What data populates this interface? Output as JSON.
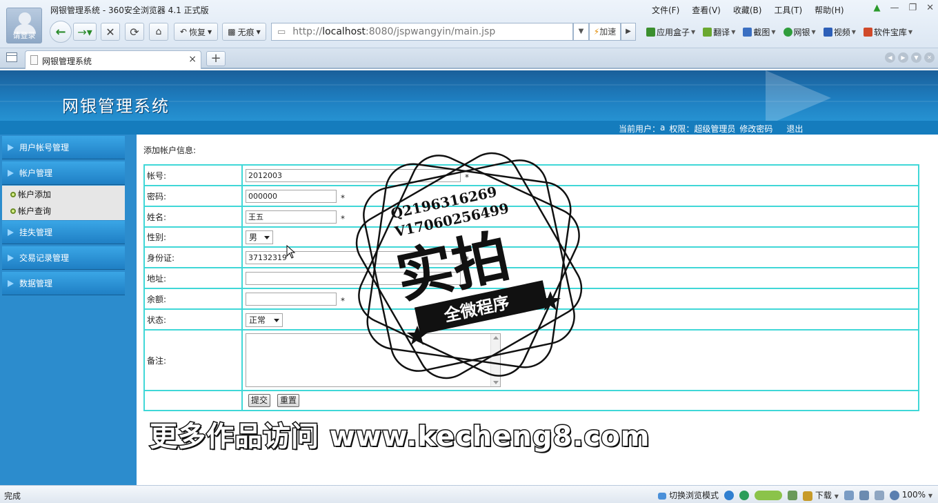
{
  "browser": {
    "title": "网银管理系统 - 360安全浏览器 4.1 正式版",
    "login_label": "请登录",
    "menu": [
      "文件(F)",
      "查看(V)",
      "收藏(B)",
      "工具(T)",
      "帮助(H)"
    ],
    "restore_label": "恢复",
    "notrace_label": "无痕",
    "url_prefix": "http://",
    "url_host": "localhost",
    "url_rest": ":8080/jspwangyin/main.jsp",
    "speed_label": "加速",
    "tools": [
      {
        "label": "应用盒子",
        "icon": "app-box-icon",
        "color": "#3b8f2e"
      },
      {
        "label": "翻译",
        "icon": "translate-icon",
        "color": "#6aa830"
      },
      {
        "label": "截图",
        "icon": "screenshot-icon",
        "color": "#3a6fc2"
      },
      {
        "label": "网银",
        "icon": "netbank-icon",
        "color": "#2f9d3c"
      },
      {
        "label": "视频",
        "icon": "video-icon",
        "color": "#2d5fb8"
      },
      {
        "label": "软件宝库",
        "icon": "software-store-icon",
        "color": "#d04a2a"
      }
    ],
    "tab_label": "网银管理系统",
    "status_text": "完成",
    "status_mode": "切换浏览模式",
    "status_download": "下载",
    "zoom": "100%"
  },
  "app": {
    "title": "网银管理系统",
    "current_user_label": "当前用户：",
    "current_user": "a",
    "role_label": "权限：",
    "role": "超级管理员",
    "change_password": "修改密码",
    "logout": "退出"
  },
  "sidebar": {
    "items": [
      {
        "label": "用户帐号管理"
      },
      {
        "label": "帐户管理"
      },
      {
        "label": "挂失管理"
      },
      {
        "label": "交易记录管理"
      },
      {
        "label": "数据管理"
      }
    ],
    "sub_items": [
      {
        "label": "帐户添加"
      },
      {
        "label": "帐户查询"
      }
    ]
  },
  "form": {
    "section_title": "添加帐户信息:",
    "required_mark": "*",
    "account": {
      "label": "帐号:",
      "value": "2012003"
    },
    "password": {
      "label": "密码:",
      "value": "000000"
    },
    "name": {
      "label": "姓名:",
      "value": "王五"
    },
    "gender": {
      "label": "性别:",
      "value": "男"
    },
    "id_card": {
      "label": "身份证:",
      "value": "37132319"
    },
    "address": {
      "label": "地址:",
      "value": ""
    },
    "balance": {
      "label": "余额:",
      "value": ""
    },
    "status": {
      "label": "状态:",
      "value": "正常"
    },
    "remark": {
      "label": "备注:",
      "value": ""
    },
    "submit_label": "提交",
    "reset_label": "重置"
  },
  "watermark": {
    "qq": "Q2196316269",
    "wx": "V17060256499",
    "big": "实拍",
    "ribbon": "全微程序",
    "promo": "更多作品访问 www.kecheng8.com"
  }
}
